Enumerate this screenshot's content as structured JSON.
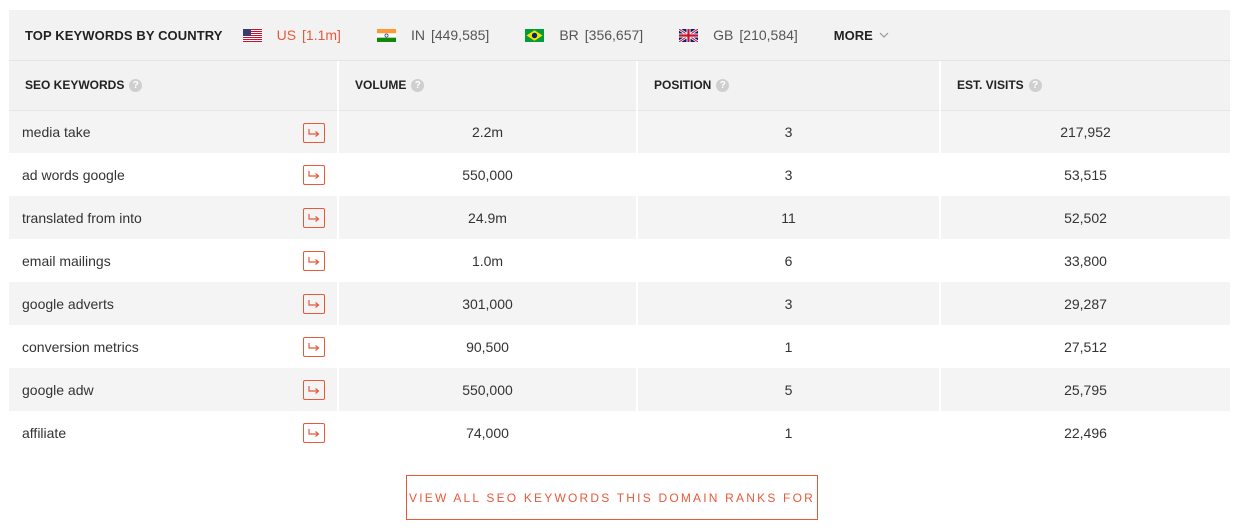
{
  "header": {
    "title": "TOP KEYWORDS BY COUNTRY",
    "countries": [
      {
        "code": "US",
        "count": "[1.1m]",
        "flag": "us-flag-icon",
        "active": true
      },
      {
        "code": "IN",
        "count": "[449,585]",
        "flag": "india-flag-icon",
        "active": false
      },
      {
        "code": "BR",
        "count": "[356,657]",
        "flag": "brazil-flag-icon",
        "active": false
      },
      {
        "code": "GB",
        "count": "[210,584]",
        "flag": "uk-flag-icon",
        "active": false
      }
    ],
    "more_label": "MORE"
  },
  "table": {
    "columns": [
      "SEO KEYWORDS",
      "VOLUME",
      "POSITION",
      "EST. VISITS"
    ],
    "rows": [
      {
        "keyword": "media take",
        "volume": "2.2m",
        "position": "3",
        "visits": "217,952"
      },
      {
        "keyword": "ad words google",
        "volume": "550,000",
        "position": "3",
        "visits": "53,515"
      },
      {
        "keyword": "translated from into",
        "volume": "24.9m",
        "position": "11",
        "visits": "52,502"
      },
      {
        "keyword": "email mailings",
        "volume": "1.0m",
        "position": "6",
        "visits": "33,800"
      },
      {
        "keyword": "google adverts",
        "volume": "301,000",
        "position": "3",
        "visits": "29,287"
      },
      {
        "keyword": "conversion metrics",
        "volume": "90,500",
        "position": "1",
        "visits": "27,512"
      },
      {
        "keyword": "google adw",
        "volume": "550,000",
        "position": "5",
        "visits": "25,795"
      },
      {
        "keyword": "affiliate",
        "volume": "74,000",
        "position": "1",
        "visits": "22,496"
      }
    ]
  },
  "view_all_label": "VIEW ALL SEO KEYWORDS THIS DOMAIN RANKS FOR",
  "colors": {
    "accent": "#e8593a",
    "row_alt": "#f4f4f4",
    "header_bg": "#f2f2f2"
  }
}
